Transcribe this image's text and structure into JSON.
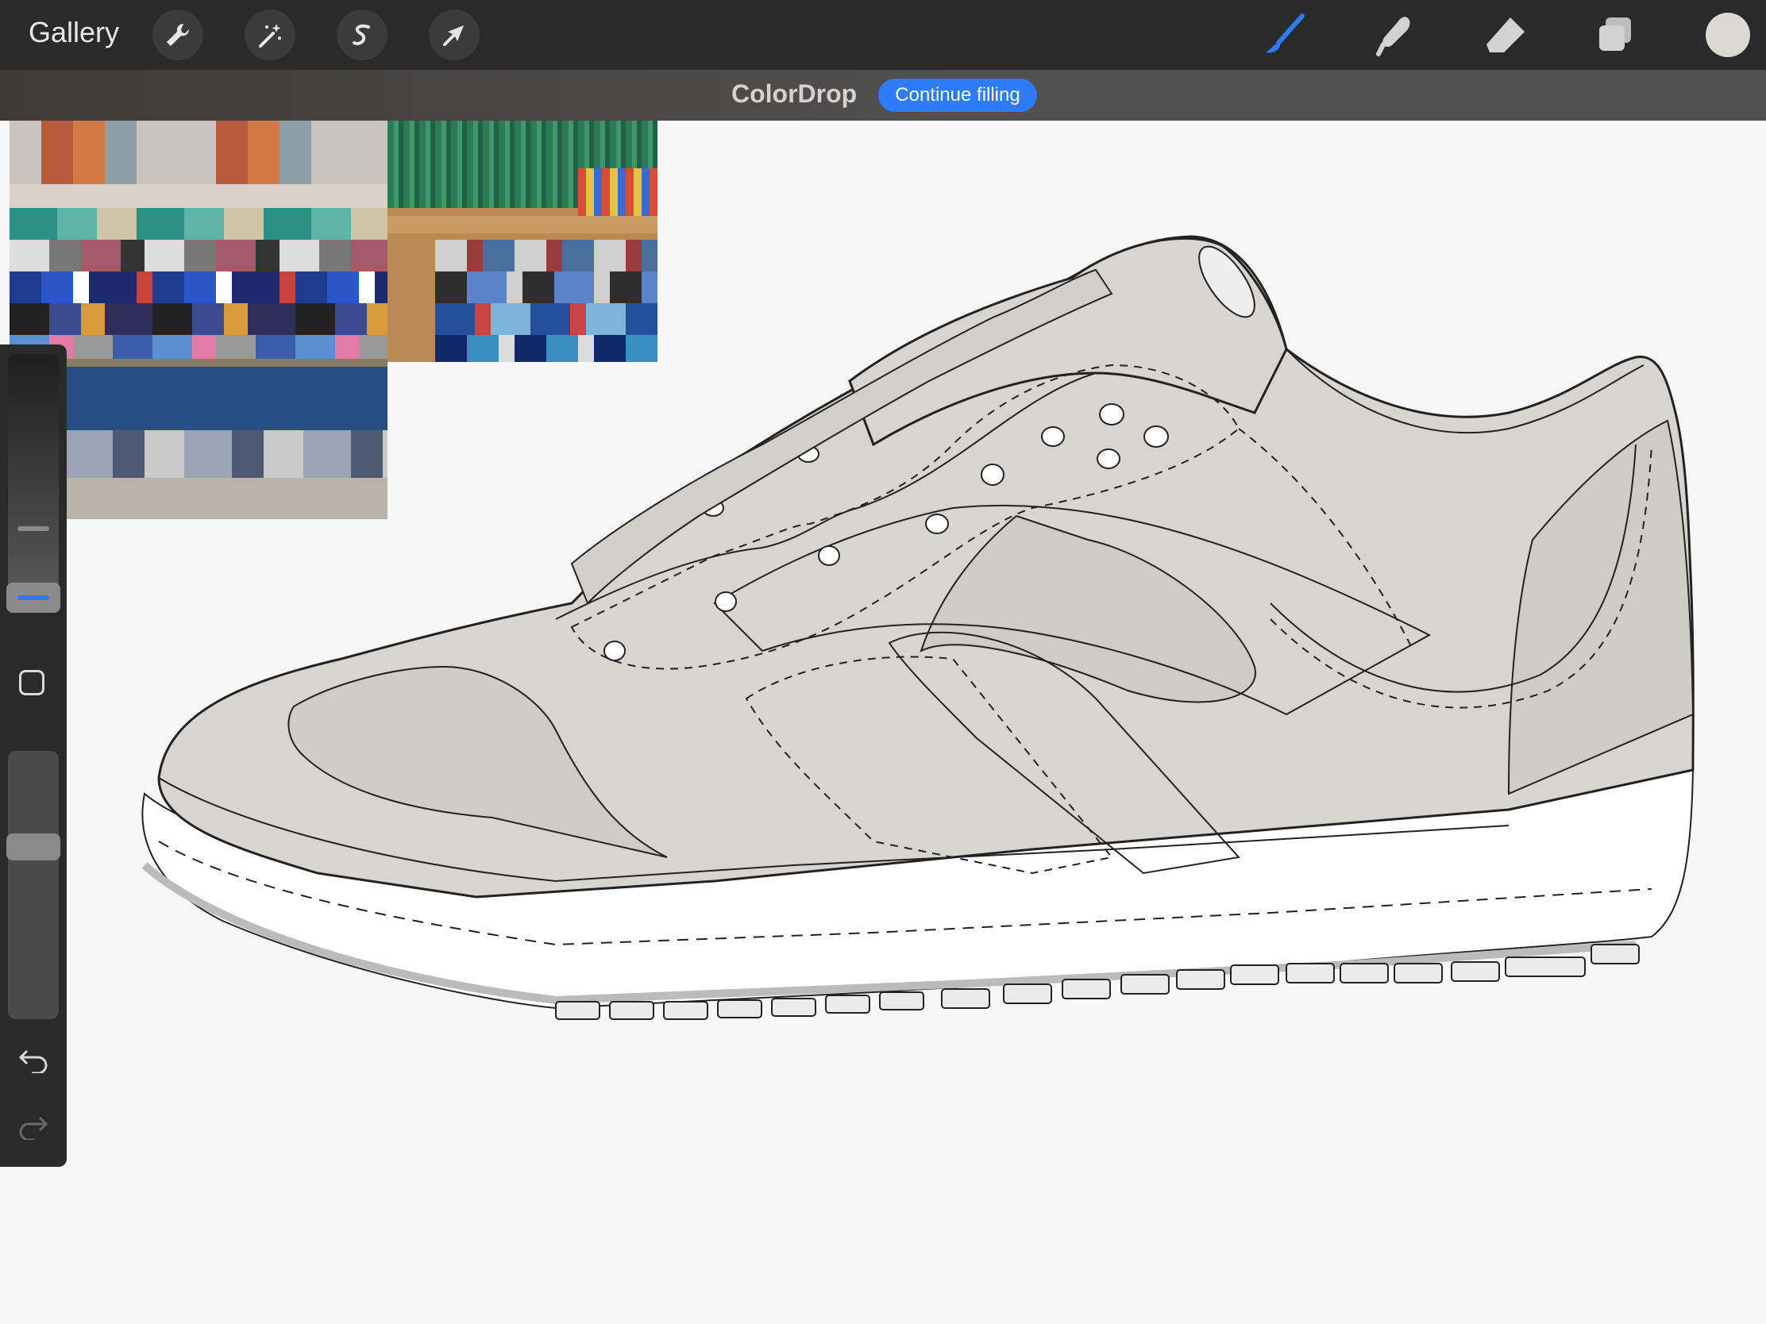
{
  "toolbar": {
    "gallery_label": "Gallery",
    "left_tools": [
      "wrench-icon",
      "magic-wand-icon",
      "selection-s-icon",
      "transform-arrow-icon"
    ],
    "right_tools": [
      "brush-icon",
      "smudge-icon",
      "eraser-icon",
      "layers-icon",
      "color-swatch"
    ],
    "active_tool": "brush",
    "active_color": "#2f7bff",
    "current_color": "#dcd8d2"
  },
  "notification": {
    "title": "ColorDrop",
    "action_label": "Continue filling",
    "action_color": "#2f7bff"
  },
  "sidebar": {
    "brush_size_level": 0.55,
    "opacity_level": 0.7,
    "tools": [
      "modify-square-icon",
      "undo-icon",
      "redo-icon"
    ]
  },
  "canvas": {
    "background": "#f6f6f6",
    "shoe_fill": "#d8d4cf",
    "shoe_panel_fill": "#cfccc4",
    "sole_fill": "#ffffff"
  }
}
